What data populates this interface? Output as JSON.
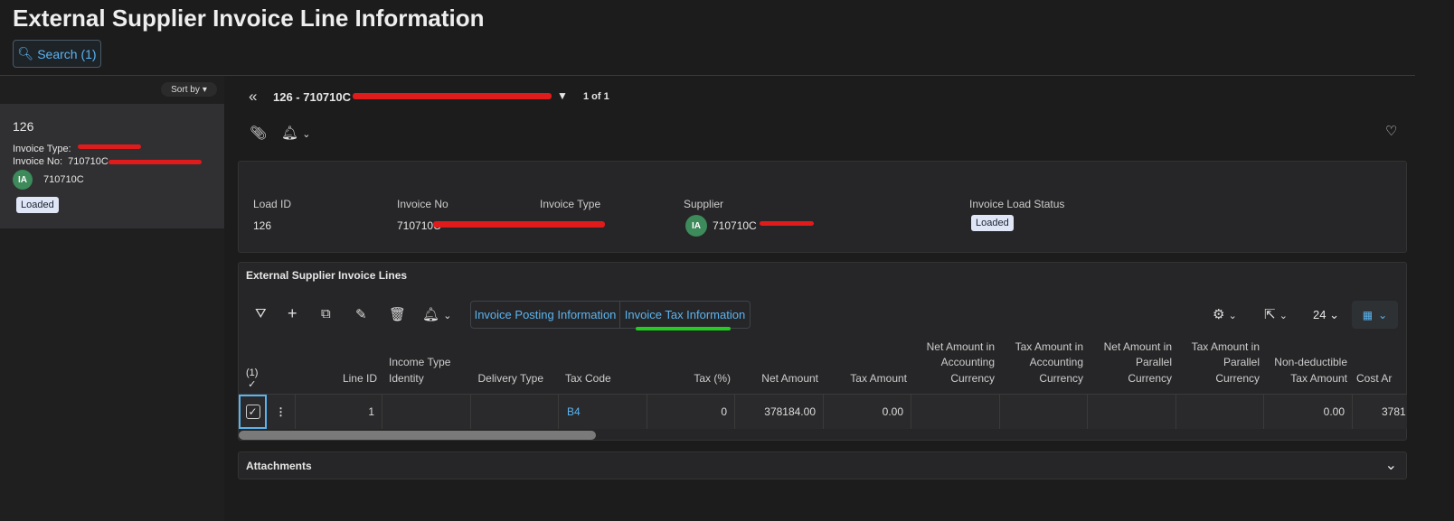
{
  "page": {
    "title": "External Supplier Invoice Line Information",
    "search_label": "Search (1)"
  },
  "list": {
    "sort_label": "Sort by",
    "card": {
      "id": "126",
      "invoice_type_label": "Invoice Type:",
      "invoice_no_label": "Invoice No:",
      "invoice_no_visible": "710710C",
      "supplier_initials": "IA",
      "supplier": "710710C",
      "status": "Loaded"
    }
  },
  "record": {
    "title_visible": "126 - 710710C",
    "pager": "1 of 1"
  },
  "header": {
    "fields": [
      {
        "label": "Load ID",
        "value": "126"
      },
      {
        "label": "Invoice No",
        "value": "710710C"
      },
      {
        "label": "Invoice Type",
        "value": ""
      },
      {
        "label": "Supplier",
        "value": "710710C",
        "initials": "IA"
      },
      {
        "label": "Invoice Load Status",
        "value": "Loaded"
      }
    ]
  },
  "lines": {
    "title": "External Supplier Invoice Lines",
    "tabs": [
      "Invoice Posting Information",
      "Invoice Tax Information"
    ],
    "page_size": "24",
    "selected_count": "(1)",
    "columns": [
      "Line ID",
      "Income Type Identity",
      "Delivery Type",
      "Tax Code",
      "Tax (%)",
      "Net Amount",
      "Tax Amount",
      "Net Amount in Accounting Currency",
      "Tax Amount in Accounting Currency",
      "Net Amount in Parallel Currency",
      "Tax Amount in Parallel Currency",
      "Non-deductible Tax Amount",
      "Cost Ar"
    ],
    "rows": [
      [
        "1",
        "",
        "",
        "B4",
        "0",
        "378184.00",
        "0.00",
        "",
        "",
        "",
        "",
        "0.00",
        "3781"
      ]
    ]
  },
  "attachments": {
    "title": "Attachments"
  },
  "colors": {
    "accent": "#5bb4f0",
    "highlight": "#22cc22",
    "redaction": "#e01b1b"
  }
}
